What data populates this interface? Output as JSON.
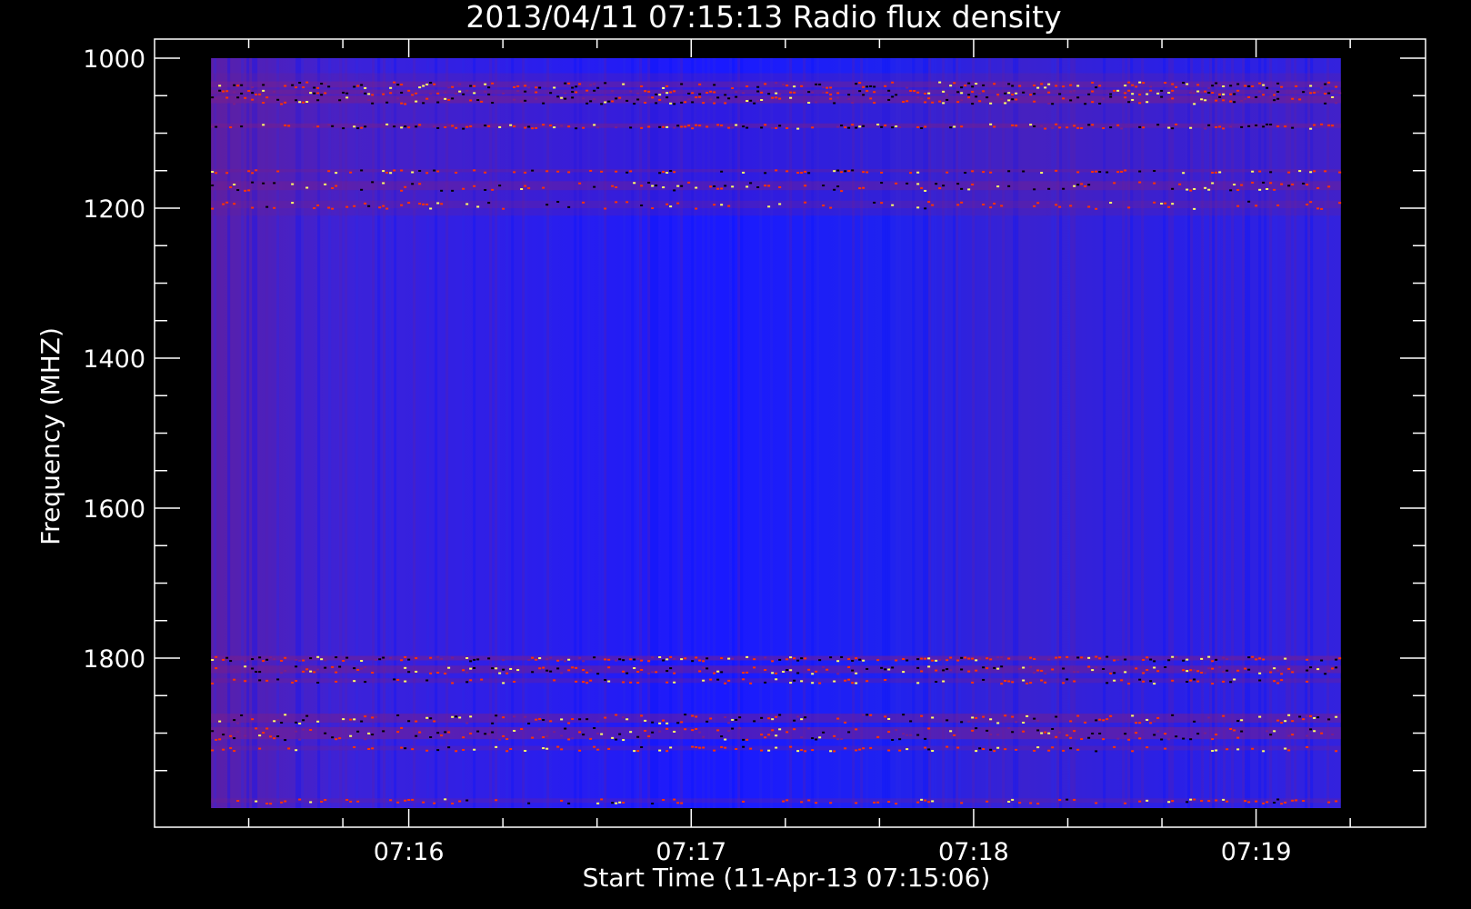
{
  "chart_data": {
    "type": "heatmap",
    "title": "2013/04/11 07:15:13 Radio flux density",
    "xlabel": "Start Time (11-Apr-13 07:15:06)",
    "ylabel": "Frequency (MHZ)",
    "x_range_seconds_after_start": [
      0,
      270
    ],
    "data_x_range_seconds_after_start": [
      12,
      252
    ],
    "y_range_mhz": [
      1000,
      2000
    ],
    "y_inverted": true,
    "data_y_range_mhz": [
      1000,
      2000
    ],
    "x_major_ticks": [
      {
        "seconds": 54,
        "label": "07:16"
      },
      {
        "seconds": 114,
        "label": "07:17"
      },
      {
        "seconds": 174,
        "label": "07:18"
      },
      {
        "seconds": 234,
        "label": "07:19"
      }
    ],
    "x_minor_ticks_seconds": [
      20,
      40,
      74,
      94,
      134,
      154,
      194,
      214,
      254
    ],
    "y_major_ticks": [
      {
        "mhz": 1000,
        "label": "1000"
      },
      {
        "mhz": 1200,
        "label": "1200"
      },
      {
        "mhz": 1400,
        "label": "1400"
      },
      {
        "mhz": 1600,
        "label": "1600"
      },
      {
        "mhz": 1800,
        "label": "1800"
      }
    ],
    "y_minor_ticks_mhz": [
      1050,
      1100,
      1150,
      1250,
      1300,
      1350,
      1450,
      1500,
      1550,
      1650,
      1700,
      1750,
      1850,
      1900,
      1950
    ],
    "colormap": {
      "low": "#0033ff",
      "mid": "#7a1f8a",
      "high": "#ff3300",
      "peak": "#ffff66",
      "null": "#000000"
    },
    "background_color": "#1a1aff",
    "interference_bands_mhz": [
      {
        "center": 1035,
        "width": 8,
        "intensity": 0.8
      },
      {
        "center": 1045,
        "width": 6,
        "intensity": 0.9
      },
      {
        "center": 1055,
        "width": 10,
        "intensity": 1.0
      },
      {
        "center": 1090,
        "width": 6,
        "intensity": 0.85
      },
      {
        "center": 1150,
        "width": 4,
        "intensity": 0.6
      },
      {
        "center": 1170,
        "width": 12,
        "intensity": 0.7
      },
      {
        "center": 1195,
        "width": 10,
        "intensity": 0.5
      },
      {
        "center": 1800,
        "width": 6,
        "intensity": 0.95
      },
      {
        "center": 1815,
        "width": 10,
        "intensity": 0.9
      },
      {
        "center": 1830,
        "width": 6,
        "intensity": 0.6
      },
      {
        "center": 1880,
        "width": 12,
        "intensity": 0.85
      },
      {
        "center": 1900,
        "width": 16,
        "intensity": 0.95
      },
      {
        "center": 1920,
        "width": 6,
        "intensity": 0.5
      },
      {
        "center": 1990,
        "width": 6,
        "intensity": 0.5
      }
    ],
    "grid": false,
    "legend": "none"
  }
}
